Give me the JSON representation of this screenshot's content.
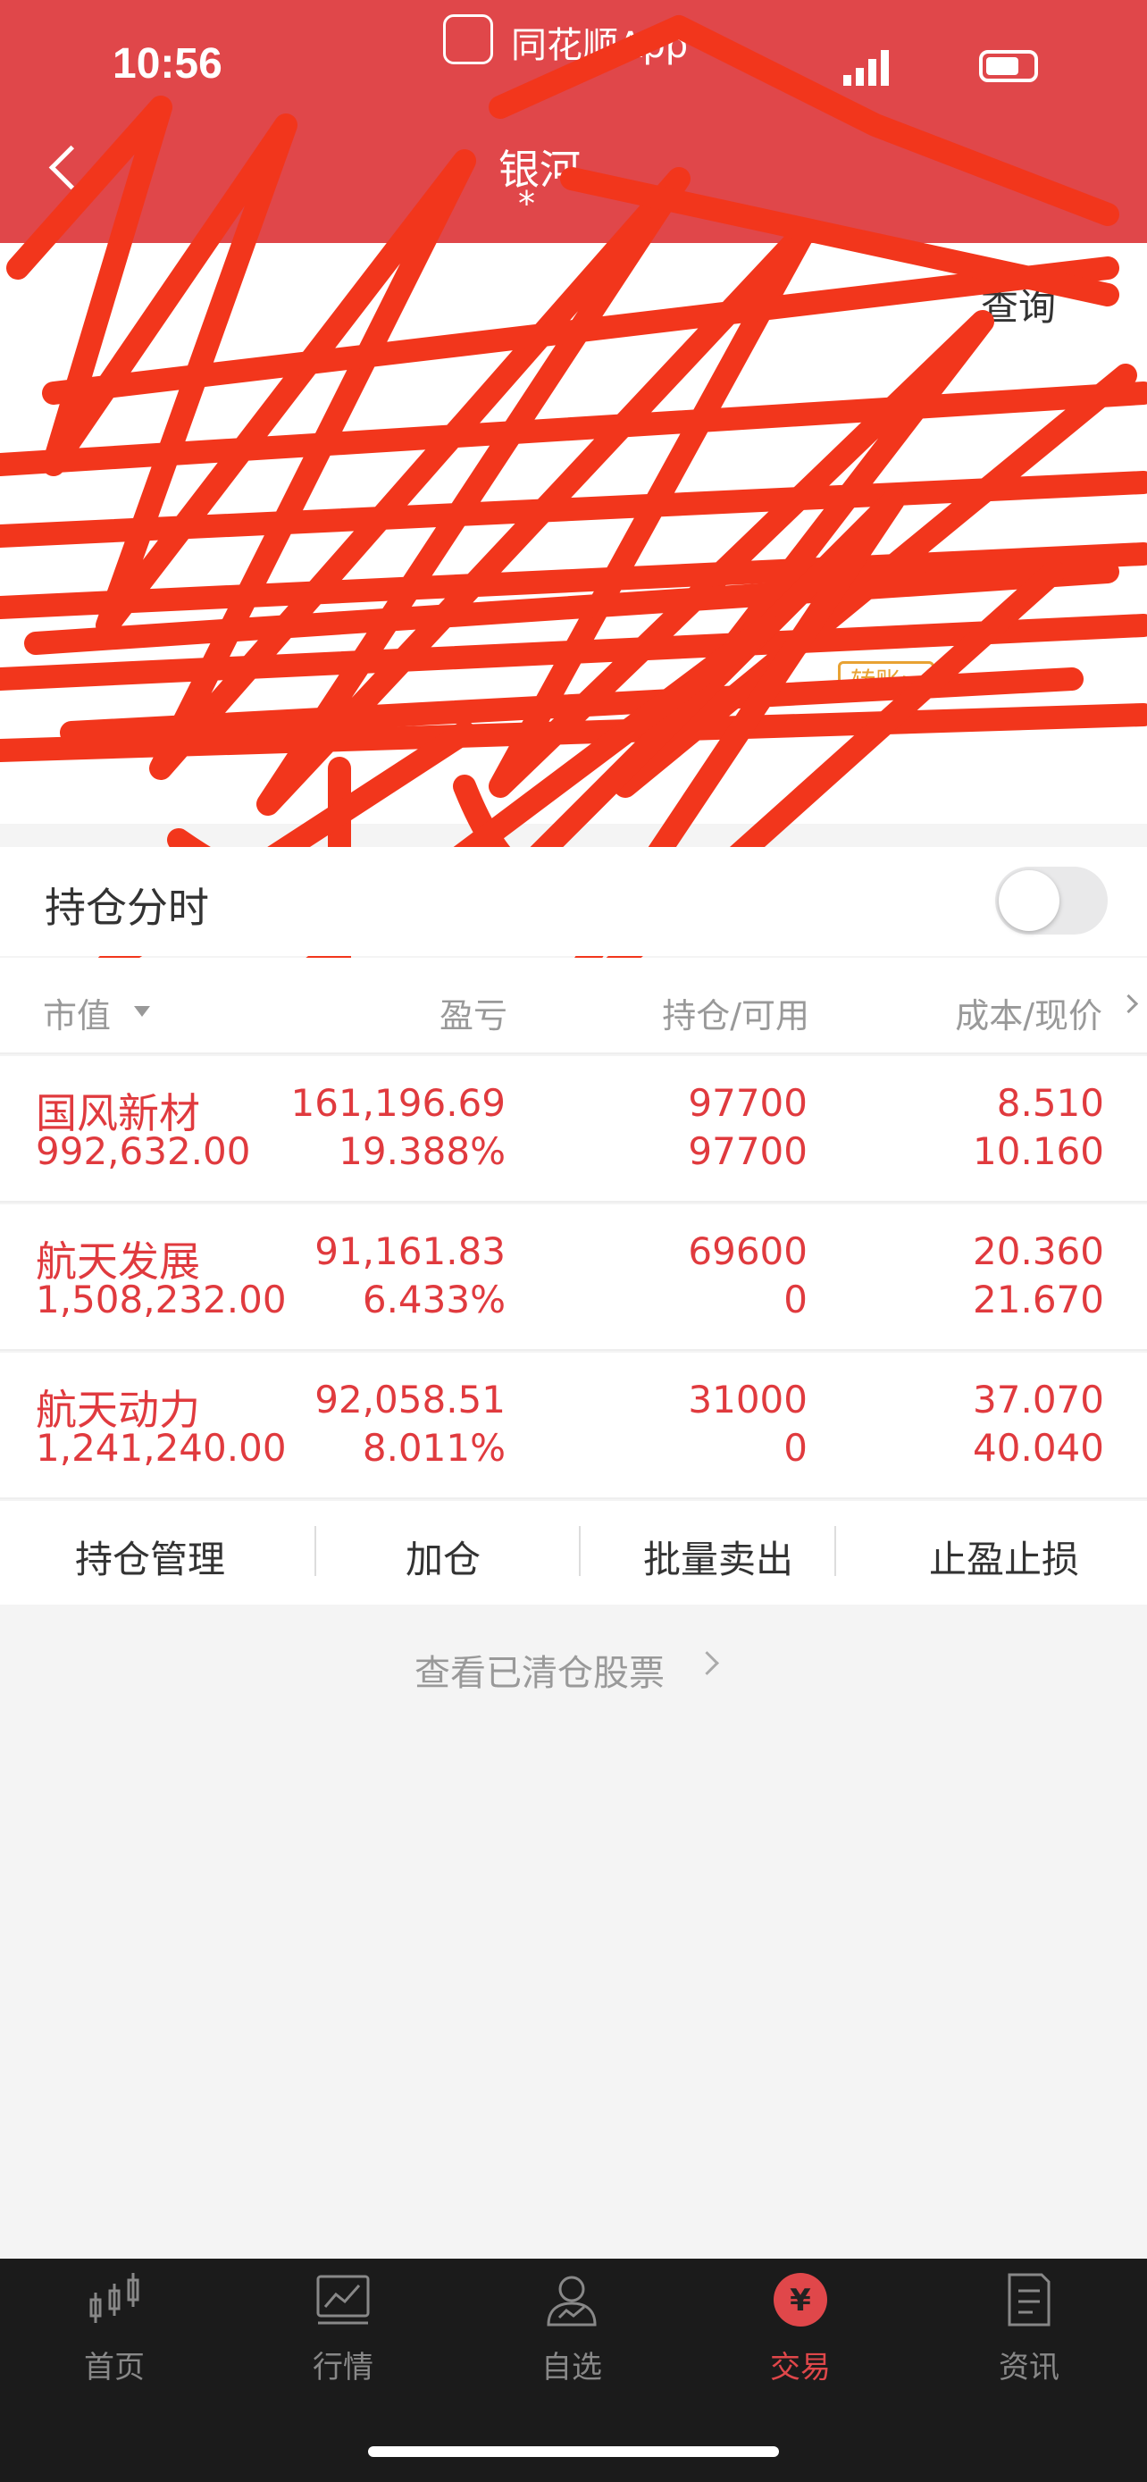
{
  "status_bar": {
    "time": "10:56",
    "app_name": "同花顺App"
  },
  "header": {
    "title": "银河",
    "subtitle": "*"
  },
  "account": {
    "tab_query": "查询",
    "transfer_label": "转账>"
  },
  "split": {
    "label": "持仓分时"
  },
  "columns": {
    "market_value": "市值",
    "profit_loss": "盈亏",
    "position": "持仓/可用",
    "cost_price": "成本/现价"
  },
  "holdings": [
    {
      "name": "国风新材",
      "market_value": "992,632.00",
      "pl": "161,196.69",
      "pl_pct": "19.388%",
      "holding": "97700",
      "available": "97700",
      "cost": "8.510",
      "current": "10.160"
    },
    {
      "name": "航天发展",
      "market_value": "1,508,232.00",
      "pl": "91,161.83",
      "pl_pct": "6.433%",
      "holding": "69600",
      "available": "0",
      "cost": "20.360",
      "current": "21.670"
    },
    {
      "name": "航天动力",
      "market_value": "1,241,240.00",
      "pl": "92,058.51",
      "pl_pct": "8.011%",
      "holding": "31000",
      "available": "0",
      "cost": "37.070",
      "current": "40.040"
    }
  ],
  "actions": {
    "manage": "持仓管理",
    "add": "加仓",
    "batch_sell": "批量卖出",
    "stop": "止盈止损"
  },
  "cleared_link": "查看已清仓股票",
  "tabs": [
    {
      "label": "首页",
      "icon": "candlestick-icon"
    },
    {
      "label": "行情",
      "icon": "chart-icon"
    },
    {
      "label": "自选",
      "icon": "user-icon"
    },
    {
      "label": "交易",
      "icon": "yen-icon",
      "active": true
    },
    {
      "label": "资讯",
      "icon": "document-icon"
    }
  ],
  "colors": {
    "brand": "#e0474a",
    "gain": "#e03a3e",
    "scribble": "#f2361c"
  }
}
